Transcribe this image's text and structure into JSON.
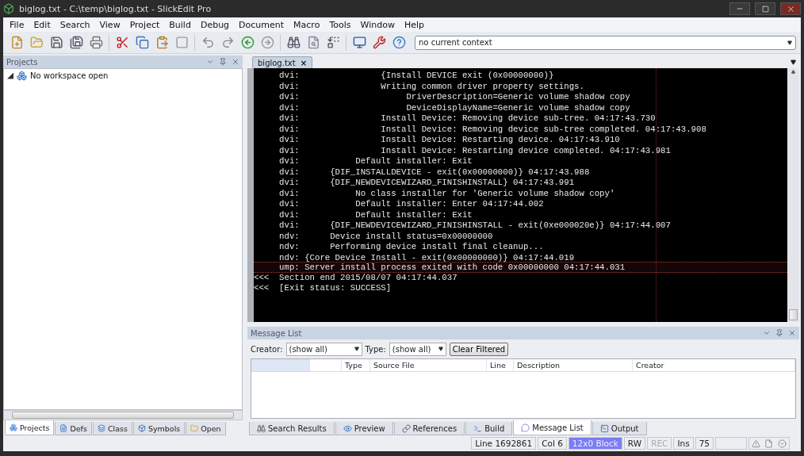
{
  "window": {
    "title": "biglog.txt - C:\\temp\\biglog.txt - SlickEdit Pro"
  },
  "menu": [
    "File",
    "Edit",
    "Search",
    "View",
    "Project",
    "Build",
    "Debug",
    "Document",
    "Macro",
    "Tools",
    "Window",
    "Help"
  ],
  "toolbar": {
    "context": "no current context"
  },
  "projects_panel": {
    "title": "Projects",
    "tree": [
      {
        "label": "No workspace open",
        "expanded": true
      }
    ],
    "tabs": [
      {
        "label": "Projects",
        "selected": true
      },
      {
        "label": "Defs",
        "selected": false
      },
      {
        "label": "Class",
        "selected": false
      },
      {
        "label": "Symbols",
        "selected": false
      },
      {
        "label": "Open",
        "selected": false
      }
    ]
  },
  "editor": {
    "tabs": [
      {
        "label": "biglog.txt",
        "selected": true,
        "close": "×"
      }
    ],
    "lines": [
      {
        "text": "     dvi:                {Install DEVICE exit (0x00000000)}",
        "current": false
      },
      {
        "text": "     dvi:                Writing common driver property settings.",
        "current": false
      },
      {
        "text": "     dvi:                     DriverDescription=Generic volume shadow copy",
        "current": false
      },
      {
        "text": "     dvi:                     DeviceDisplayName=Generic volume shadow copy",
        "current": false
      },
      {
        "text": "     dvi:                Install Device: Removing device sub-tree. 04:17:43.730",
        "current": false
      },
      {
        "text": "     dvi:                Install Device: Removing device sub-tree completed. 04:17:43.908",
        "current": false
      },
      {
        "text": "     dvi:                Install Device: Restarting device. 04:17:43.910",
        "current": false
      },
      {
        "text": "     dvi:                Install Device: Restarting device completed. 04:17:43.981",
        "current": false
      },
      {
        "text": "     dvi:           Default installer: Exit",
        "current": false
      },
      {
        "text": "     dvi:      {DIF_INSTALLDEVICE - exit(0x00000000)} 04:17:43.988",
        "current": false
      },
      {
        "text": "     dvi:      {DIF_NEWDEVICEWIZARD_FINISHINSTALL} 04:17:43.991",
        "current": false
      },
      {
        "text": "     dvi:           No class installer for 'Generic volume shadow copy'",
        "current": false
      },
      {
        "text": "     dvi:           Default installer: Enter 04:17:44.002",
        "current": false
      },
      {
        "text": "     dvi:           Default installer: Exit",
        "current": false
      },
      {
        "text": "     dvi:      {DIF_NEWDEVICEWIZARD_FINISHINSTALL - exit(0xe000020e)} 04:17:44.007",
        "current": false
      },
      {
        "text": "     ndv:      Device install status=0x00000000",
        "current": false
      },
      {
        "text": "     ndv:      Performing device install final cleanup...",
        "current": false
      },
      {
        "text": "     ndv: {Core Device Install - exit(0x00000000)} 04:17:44.019",
        "current": false
      },
      {
        "text": "     ump: Server install process exited with code 0x00000000 04:17:44.031",
        "current": true
      },
      {
        "text": "<<<  Section end 2015/08/07 04:17:44.037",
        "current": false
      },
      {
        "text": "<<<  [Exit status: SUCCESS]",
        "current": false
      }
    ]
  },
  "message_list": {
    "title": "Message List",
    "filters": [
      {
        "label": "Creator:",
        "value": "(show all)"
      },
      {
        "label": "Type:",
        "value": "(show all)"
      }
    ],
    "clear_button": "Clear Filtered",
    "columns": [
      "Type",
      "Source File",
      "Line",
      "Description",
      "Creator"
    ]
  },
  "bottom_tabs": [
    {
      "label": "Search Results",
      "selected": false
    },
    {
      "label": "Preview",
      "selected": false
    },
    {
      "label": "References",
      "selected": false
    },
    {
      "label": "Build",
      "selected": false
    },
    {
      "label": "Message List",
      "selected": true
    },
    {
      "label": "Output",
      "selected": false
    }
  ],
  "status_bar": [
    {
      "text": "Line 1692861",
      "kind": "normal"
    },
    {
      "text": "Col 6",
      "kind": "normal"
    },
    {
      "text": "12x0 Block",
      "kind": "highlight"
    },
    {
      "text": "RW",
      "kind": "normal"
    },
    {
      "text": "REC",
      "kind": "disabled"
    },
    {
      "text": "Ins",
      "kind": "normal"
    },
    {
      "text": "75",
      "kind": "normal"
    }
  ]
}
